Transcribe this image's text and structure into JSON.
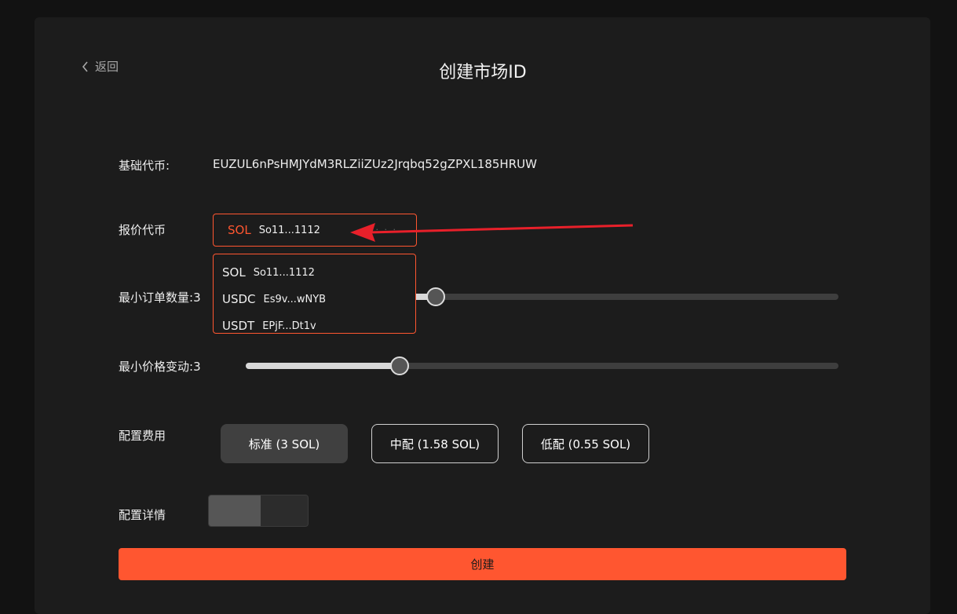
{
  "header": {
    "back_label": "返回",
    "title": "创建市场ID"
  },
  "base_token": {
    "label": "基础代币:",
    "value": "EUZUL6nPsHMJYdM3RLZiiZUz2Jrqbq52gZPXL185HRUW"
  },
  "quote_token": {
    "label": "报价代币",
    "selected": {
      "symbol": "SOL",
      "address": "So11...1112"
    },
    "options": [
      {
        "symbol": "SOL",
        "address": "So11...1112"
      },
      {
        "symbol": "USDC",
        "address": "Es9v...wNYB"
      },
      {
        "symbol": "USDT",
        "address": "EPjF...Dt1v"
      }
    ]
  },
  "min_order_size": {
    "label": "最小订单数量:",
    "value": "3",
    "level": 0.32
  },
  "min_price_tick": {
    "label": "最小价格变动:",
    "value": "3",
    "level": 0.26
  },
  "fee": {
    "label": "配置费用",
    "options": [
      {
        "label": "标准 (3 SOL)",
        "active": true
      },
      {
        "label": "中配 (1.58 SOL)",
        "active": false
      },
      {
        "label": "低配 (0.55 SOL)",
        "active": false
      }
    ]
  },
  "details": {
    "label": "配置详情",
    "enabled": false
  },
  "create_label": "创建",
  "colors": {
    "accent": "#ff5630",
    "annotation_arrow": "#e8202a"
  }
}
